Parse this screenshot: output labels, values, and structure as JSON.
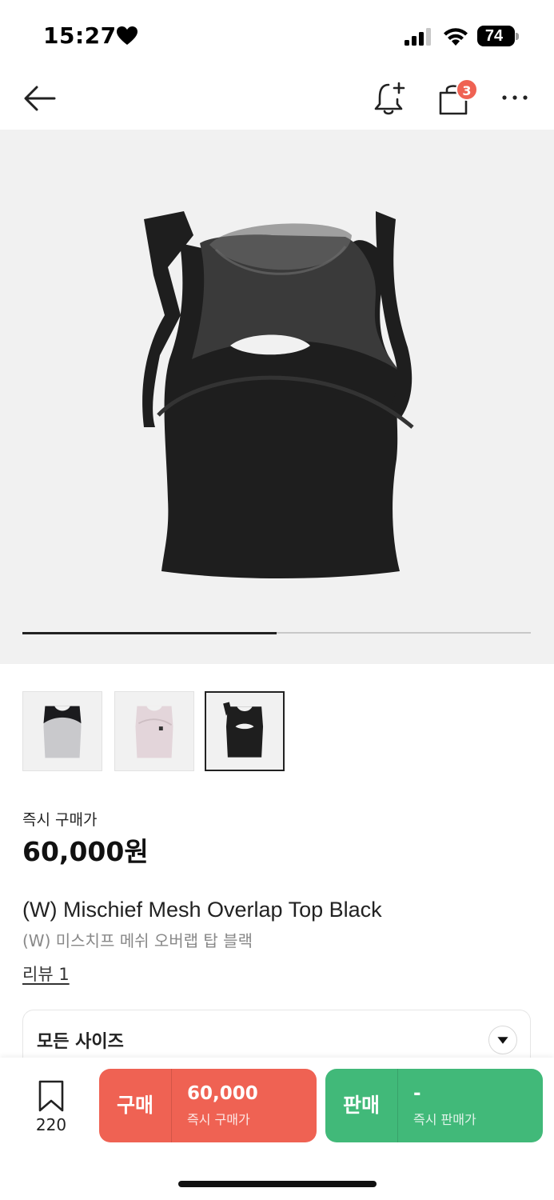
{
  "status_bar": {
    "time": "15:27",
    "battery_level": "74"
  },
  "nav": {
    "cart_badge_count": "3",
    "icons": [
      "back-arrow-icon",
      "bell-plus-icon",
      "shopping-bag-icon",
      "more-icon"
    ]
  },
  "carousel": {
    "progress_fraction": 0.5
  },
  "thumbnails": [
    {
      "variant": "grey-black",
      "selected": false
    },
    {
      "variant": "pink",
      "selected": false
    },
    {
      "variant": "black",
      "selected": true
    }
  ],
  "price": {
    "label": "즉시 구매가",
    "value": "60,000원"
  },
  "product": {
    "name_en": "(W) Mischief Mesh Overlap Top Black",
    "name_ko": "(W) 미스치프 메쉬 오버랩 탑 블랙",
    "review_link": "리뷰 1"
  },
  "size_select": {
    "label": "모든 사이즈"
  },
  "bottom_bar": {
    "bookmark_count": "220",
    "buy": {
      "label": "구매",
      "price": "60,000",
      "sub": "즉시 구매가",
      "color": "#ef6253"
    },
    "sell": {
      "label": "판매",
      "price": "-",
      "sub": "즉시 판매가",
      "color": "#41b979"
    }
  }
}
